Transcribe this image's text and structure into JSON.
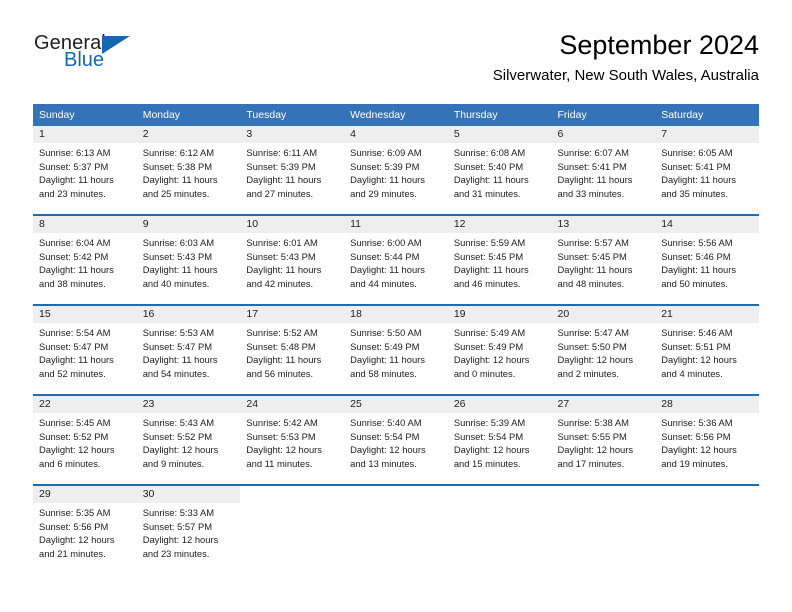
{
  "brand": {
    "name_top": "General",
    "name_bottom": "Blue",
    "accent_color": "#1567b2",
    "triangle_icon": "triangle-icon"
  },
  "header": {
    "title": "September 2024",
    "subtitle": "Silverwater, New South Wales, Australia"
  },
  "calendar": {
    "header_bg": "#3573b9",
    "row_divider_color": "#1f6cb0",
    "daynum_bg": "#eeeeee",
    "weekday_headers": [
      "Sunday",
      "Monday",
      "Tuesday",
      "Wednesday",
      "Thursday",
      "Friday",
      "Saturday"
    ],
    "weeks": [
      [
        {
          "day": "1",
          "sunrise": "Sunrise: 6:13 AM",
          "sunset": "Sunset: 5:37 PM",
          "daylight_1": "Daylight: 11 hours",
          "daylight_2": "and 23 minutes."
        },
        {
          "day": "2",
          "sunrise": "Sunrise: 6:12 AM",
          "sunset": "Sunset: 5:38 PM",
          "daylight_1": "Daylight: 11 hours",
          "daylight_2": "and 25 minutes."
        },
        {
          "day": "3",
          "sunrise": "Sunrise: 6:11 AM",
          "sunset": "Sunset: 5:39 PM",
          "daylight_1": "Daylight: 11 hours",
          "daylight_2": "and 27 minutes."
        },
        {
          "day": "4",
          "sunrise": "Sunrise: 6:09 AM",
          "sunset": "Sunset: 5:39 PM",
          "daylight_1": "Daylight: 11 hours",
          "daylight_2": "and 29 minutes."
        },
        {
          "day": "5",
          "sunrise": "Sunrise: 6:08 AM",
          "sunset": "Sunset: 5:40 PM",
          "daylight_1": "Daylight: 11 hours",
          "daylight_2": "and 31 minutes."
        },
        {
          "day": "6",
          "sunrise": "Sunrise: 6:07 AM",
          "sunset": "Sunset: 5:41 PM",
          "daylight_1": "Daylight: 11 hours",
          "daylight_2": "and 33 minutes."
        },
        {
          "day": "7",
          "sunrise": "Sunrise: 6:05 AM",
          "sunset": "Sunset: 5:41 PM",
          "daylight_1": "Daylight: 11 hours",
          "daylight_2": "and 35 minutes."
        }
      ],
      [
        {
          "day": "8",
          "sunrise": "Sunrise: 6:04 AM",
          "sunset": "Sunset: 5:42 PM",
          "daylight_1": "Daylight: 11 hours",
          "daylight_2": "and 38 minutes."
        },
        {
          "day": "9",
          "sunrise": "Sunrise: 6:03 AM",
          "sunset": "Sunset: 5:43 PM",
          "daylight_1": "Daylight: 11 hours",
          "daylight_2": "and 40 minutes."
        },
        {
          "day": "10",
          "sunrise": "Sunrise: 6:01 AM",
          "sunset": "Sunset: 5:43 PM",
          "daylight_1": "Daylight: 11 hours",
          "daylight_2": "and 42 minutes."
        },
        {
          "day": "11",
          "sunrise": "Sunrise: 6:00 AM",
          "sunset": "Sunset: 5:44 PM",
          "daylight_1": "Daylight: 11 hours",
          "daylight_2": "and 44 minutes."
        },
        {
          "day": "12",
          "sunrise": "Sunrise: 5:59 AM",
          "sunset": "Sunset: 5:45 PM",
          "daylight_1": "Daylight: 11 hours",
          "daylight_2": "and 46 minutes."
        },
        {
          "day": "13",
          "sunrise": "Sunrise: 5:57 AM",
          "sunset": "Sunset: 5:45 PM",
          "daylight_1": "Daylight: 11 hours",
          "daylight_2": "and 48 minutes."
        },
        {
          "day": "14",
          "sunrise": "Sunrise: 5:56 AM",
          "sunset": "Sunset: 5:46 PM",
          "daylight_1": "Daylight: 11 hours",
          "daylight_2": "and 50 minutes."
        }
      ],
      [
        {
          "day": "15",
          "sunrise": "Sunrise: 5:54 AM",
          "sunset": "Sunset: 5:47 PM",
          "daylight_1": "Daylight: 11 hours",
          "daylight_2": "and 52 minutes."
        },
        {
          "day": "16",
          "sunrise": "Sunrise: 5:53 AM",
          "sunset": "Sunset: 5:47 PM",
          "daylight_1": "Daylight: 11 hours",
          "daylight_2": "and 54 minutes."
        },
        {
          "day": "17",
          "sunrise": "Sunrise: 5:52 AM",
          "sunset": "Sunset: 5:48 PM",
          "daylight_1": "Daylight: 11 hours",
          "daylight_2": "and 56 minutes."
        },
        {
          "day": "18",
          "sunrise": "Sunrise: 5:50 AM",
          "sunset": "Sunset: 5:49 PM",
          "daylight_1": "Daylight: 11 hours",
          "daylight_2": "and 58 minutes."
        },
        {
          "day": "19",
          "sunrise": "Sunrise: 5:49 AM",
          "sunset": "Sunset: 5:49 PM",
          "daylight_1": "Daylight: 12 hours",
          "daylight_2": "and 0 minutes."
        },
        {
          "day": "20",
          "sunrise": "Sunrise: 5:47 AM",
          "sunset": "Sunset: 5:50 PM",
          "daylight_1": "Daylight: 12 hours",
          "daylight_2": "and 2 minutes."
        },
        {
          "day": "21",
          "sunrise": "Sunrise: 5:46 AM",
          "sunset": "Sunset: 5:51 PM",
          "daylight_1": "Daylight: 12 hours",
          "daylight_2": "and 4 minutes."
        }
      ],
      [
        {
          "day": "22",
          "sunrise": "Sunrise: 5:45 AM",
          "sunset": "Sunset: 5:52 PM",
          "daylight_1": "Daylight: 12 hours",
          "daylight_2": "and 6 minutes."
        },
        {
          "day": "23",
          "sunrise": "Sunrise: 5:43 AM",
          "sunset": "Sunset: 5:52 PM",
          "daylight_1": "Daylight: 12 hours",
          "daylight_2": "and 9 minutes."
        },
        {
          "day": "24",
          "sunrise": "Sunrise: 5:42 AM",
          "sunset": "Sunset: 5:53 PM",
          "daylight_1": "Daylight: 12 hours",
          "daylight_2": "and 11 minutes."
        },
        {
          "day": "25",
          "sunrise": "Sunrise: 5:40 AM",
          "sunset": "Sunset: 5:54 PM",
          "daylight_1": "Daylight: 12 hours",
          "daylight_2": "and 13 minutes."
        },
        {
          "day": "26",
          "sunrise": "Sunrise: 5:39 AM",
          "sunset": "Sunset: 5:54 PM",
          "daylight_1": "Daylight: 12 hours",
          "daylight_2": "and 15 minutes."
        },
        {
          "day": "27",
          "sunrise": "Sunrise: 5:38 AM",
          "sunset": "Sunset: 5:55 PM",
          "daylight_1": "Daylight: 12 hours",
          "daylight_2": "and 17 minutes."
        },
        {
          "day": "28",
          "sunrise": "Sunrise: 5:36 AM",
          "sunset": "Sunset: 5:56 PM",
          "daylight_1": "Daylight: 12 hours",
          "daylight_2": "and 19 minutes."
        }
      ],
      [
        {
          "day": "29",
          "sunrise": "Sunrise: 5:35 AM",
          "sunset": "Sunset: 5:56 PM",
          "daylight_1": "Daylight: 12 hours",
          "daylight_2": "and 21 minutes."
        },
        {
          "day": "30",
          "sunrise": "Sunrise: 5:33 AM",
          "sunset": "Sunset: 5:57 PM",
          "daylight_1": "Daylight: 12 hours",
          "daylight_2": "and 23 minutes."
        },
        {
          "day": "",
          "sunrise": "",
          "sunset": "",
          "daylight_1": "",
          "daylight_2": ""
        },
        {
          "day": "",
          "sunrise": "",
          "sunset": "",
          "daylight_1": "",
          "daylight_2": ""
        },
        {
          "day": "",
          "sunrise": "",
          "sunset": "",
          "daylight_1": "",
          "daylight_2": ""
        },
        {
          "day": "",
          "sunrise": "",
          "sunset": "",
          "daylight_1": "",
          "daylight_2": ""
        },
        {
          "day": "",
          "sunrise": "",
          "sunset": "",
          "daylight_1": "",
          "daylight_2": ""
        }
      ]
    ]
  }
}
